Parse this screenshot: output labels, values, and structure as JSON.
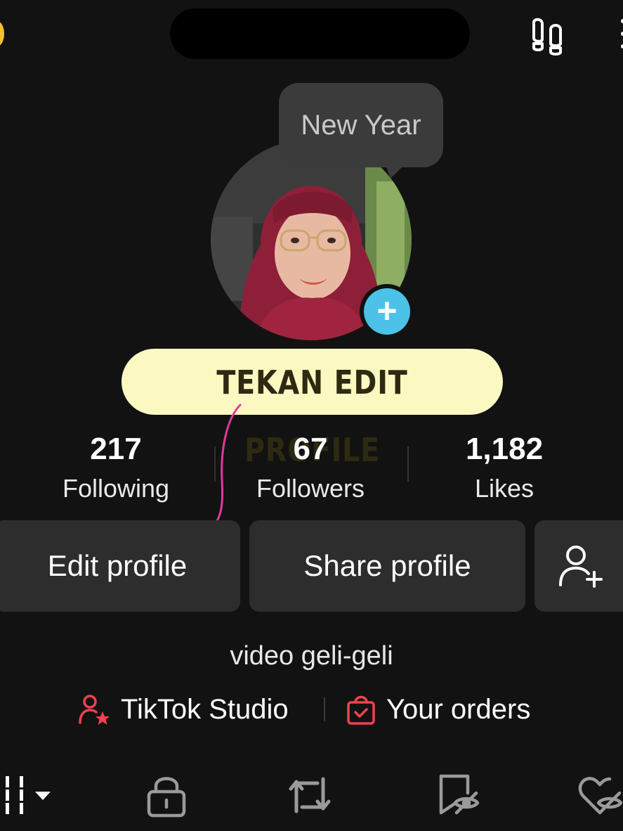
{
  "top_bar": {
    "title": "",
    "footprint_icon": "footprints-icon"
  },
  "avatar": {
    "add_icon": "plus-icon",
    "accent": "#4cc2e8"
  },
  "note_bubble": {
    "text": "New Year"
  },
  "annotation": {
    "text": "TEKAN EDIT PROFILE",
    "arrow_color": "#e0399b"
  },
  "stats": [
    {
      "value": "217",
      "label": "Following"
    },
    {
      "value": "67",
      "label": "Followers"
    },
    {
      "value": "1,182",
      "label": "Likes"
    }
  ],
  "buttons": {
    "edit": "Edit profile",
    "share": "Share profile",
    "add_friend_icon": "add-user-icon"
  },
  "bio": "video geli-geli",
  "links": {
    "studio": {
      "label": "TikTok Studio",
      "icon": "creator-star-icon"
    },
    "orders": {
      "label": "Your orders",
      "icon": "shopping-bag-icon"
    },
    "accent": "#f0424f"
  },
  "tabs": [
    {
      "icon": "grid-dropdown-icon"
    },
    {
      "icon": "lock-icon"
    },
    {
      "icon": "repost-icon"
    },
    {
      "icon": "bookmark-hidden-icon"
    },
    {
      "icon": "liked-hidden-icon"
    }
  ]
}
